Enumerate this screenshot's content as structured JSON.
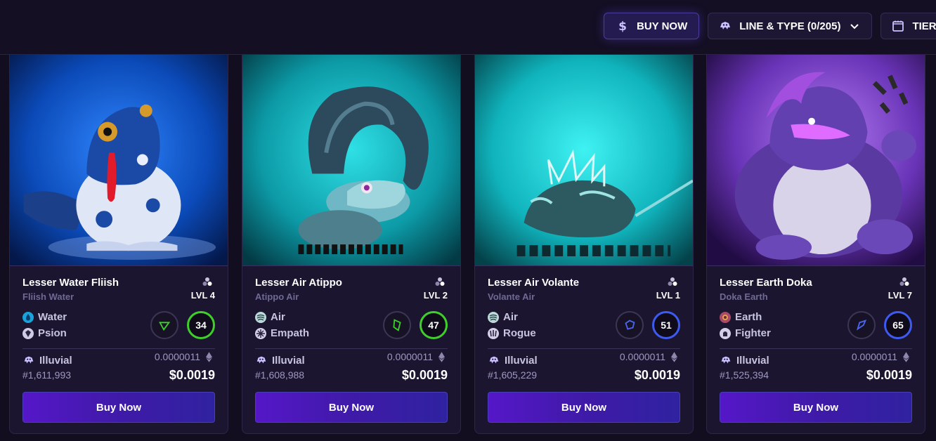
{
  "toolbar": {
    "buy_now": "BUY NOW",
    "line_type": "LINE & TYPE (0/205)",
    "tier": "TIER"
  },
  "cards": [
    {
      "name": "Lesser Water Fliish",
      "subtitle": "Fliish Water",
      "level": "LVL 4",
      "affinity": "Water",
      "class": "Psion",
      "power": "34",
      "power_ring": "green",
      "collection": "Illuvial",
      "number": "#1,611,993",
      "eth_price": "0.0000011",
      "usd_price": "$0.0019",
      "buy_label": "Buy Now",
      "bg_color": "#0a4fb8"
    },
    {
      "name": "Lesser Air Atippo",
      "subtitle": "Atippo Air",
      "level": "LVL 2",
      "affinity": "Air",
      "class": "Empath",
      "power": "47",
      "power_ring": "green",
      "collection": "Illuvial",
      "number": "#1,608,988",
      "eth_price": "0.0000011",
      "usd_price": "$0.0019",
      "buy_label": "Buy Now",
      "bg_color": "#0fa9b1"
    },
    {
      "name": "Lesser Air Volante",
      "subtitle": "Volante Air",
      "level": "LVL 1",
      "affinity": "Air",
      "class": "Rogue",
      "power": "51",
      "power_ring": "blue",
      "collection": "Illuvial",
      "number": "#1,605,229",
      "eth_price": "0.0000011",
      "usd_price": "$0.0019",
      "buy_label": "Buy Now",
      "bg_color": "#13b9c1"
    },
    {
      "name": "Lesser Earth Doka",
      "subtitle": "Doka Earth",
      "level": "LVL 7",
      "affinity": "Earth",
      "class": "Fighter",
      "power": "65",
      "power_ring": "blue",
      "collection": "Illuvial",
      "number": "#1,525,394",
      "eth_price": "0.0000011",
      "usd_price": "$0.0019",
      "buy_label": "Buy Now",
      "bg_color": "#7a3fc9"
    }
  ]
}
